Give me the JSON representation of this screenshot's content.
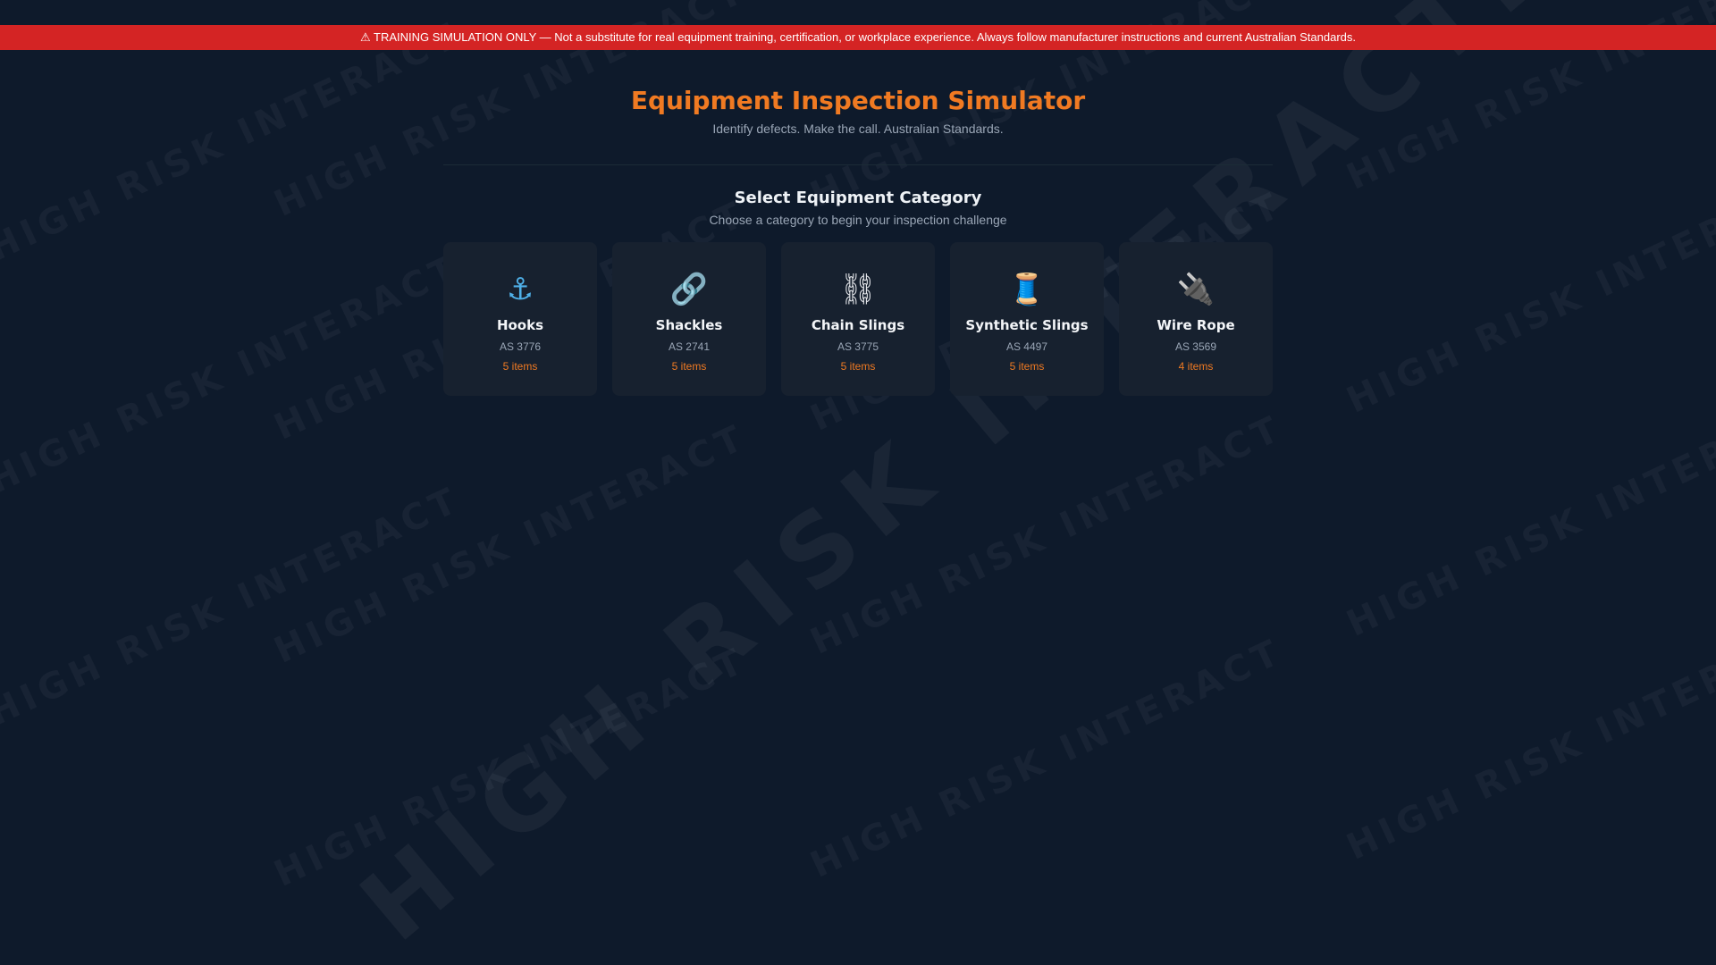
{
  "banner": {
    "text": "⚠ TRAINING SIMULATION ONLY — Not a substitute for real equipment training, certification, or workplace experience. Always follow manufacturer instructions and current Australian Standards."
  },
  "header": {
    "title": "Equipment Inspection Simulator",
    "subtitle": "Identify defects. Make the call. Australian Standards."
  },
  "section": {
    "title": "Select Equipment Category",
    "subtitle": "Choose a category to begin your inspection challenge"
  },
  "categories": [
    {
      "icon": "⚓",
      "icon_name": "anchor-icon",
      "name": "Hooks",
      "standard": "AS 3776",
      "count": "5 items"
    },
    {
      "icon": "🔗",
      "icon_name": "link-icon",
      "name": "Shackles",
      "standard": "AS 2741",
      "count": "5 items"
    },
    {
      "icon": "⛓",
      "icon_name": "chain-icon",
      "name": "Chain Slings",
      "standard": "AS 3775",
      "count": "5 items"
    },
    {
      "icon": "🧵",
      "icon_name": "thread-spool-icon",
      "name": "Synthetic Slings",
      "standard": "AS 4497",
      "count": "5 items"
    },
    {
      "icon": "🔌",
      "icon_name": "plug-icon",
      "name": "Wire Rope",
      "standard": "AS 3569",
      "count": "4 items"
    }
  ],
  "watermark": {
    "small_text": "HIGH RISK INTERACT",
    "big_text": "HIGH RISK INTERACTIVE"
  },
  "colors": {
    "background": "#0e1a2b",
    "banner": "#d42424",
    "accent": "#f07a22",
    "card": "#17212f",
    "muted_text": "#9aa6b6"
  }
}
